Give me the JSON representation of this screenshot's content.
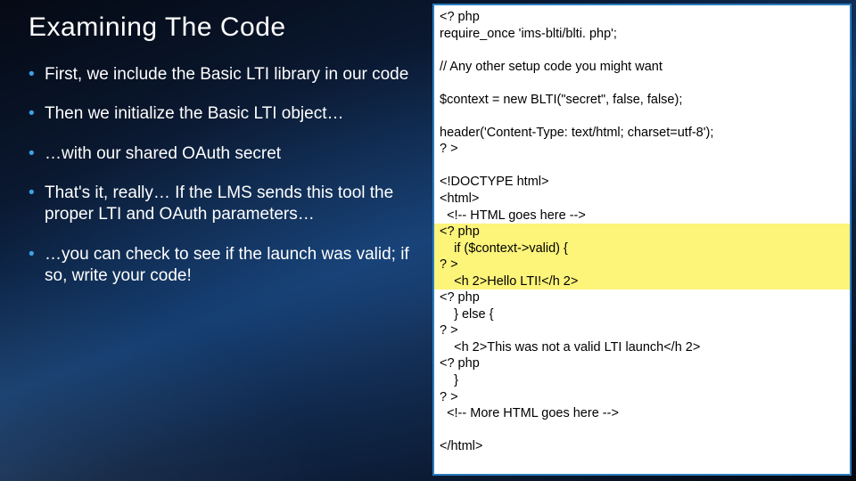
{
  "title": "Examining The Code",
  "bullets": [
    "First, we include the Basic LTI library in our code",
    "Then we initialize the Basic LTI object…",
    "…with our shared OAuth secret",
    "That's it, really… If the LMS sends this tool the proper LTI and OAuth parameters…",
    "…you can check to see if the launch was valid; if so, write your code!"
  ],
  "code": {
    "pre": "<? php\nrequire_once 'ims-blti/blti. php';\n\n// Any other setup code you might want\n\n$context = new BLTI(\"secret\", false, false);\n\nheader('Content-Type: text/html; charset=utf-8');\n? >\n\n<!DOCTYPE html>\n<html>\n  <!-- HTML goes here -->",
    "hl": "<? php\n    if ($context->valid) {\n? >\n    <h 2>Hello LTI!</h 2>",
    "post": "<? php\n    } else {\n? >\n    <h 2>This was not a valid LTI launch</h 2>\n<? php\n    }\n? >\n  <!-- More HTML goes here -->\n\n</html>"
  }
}
